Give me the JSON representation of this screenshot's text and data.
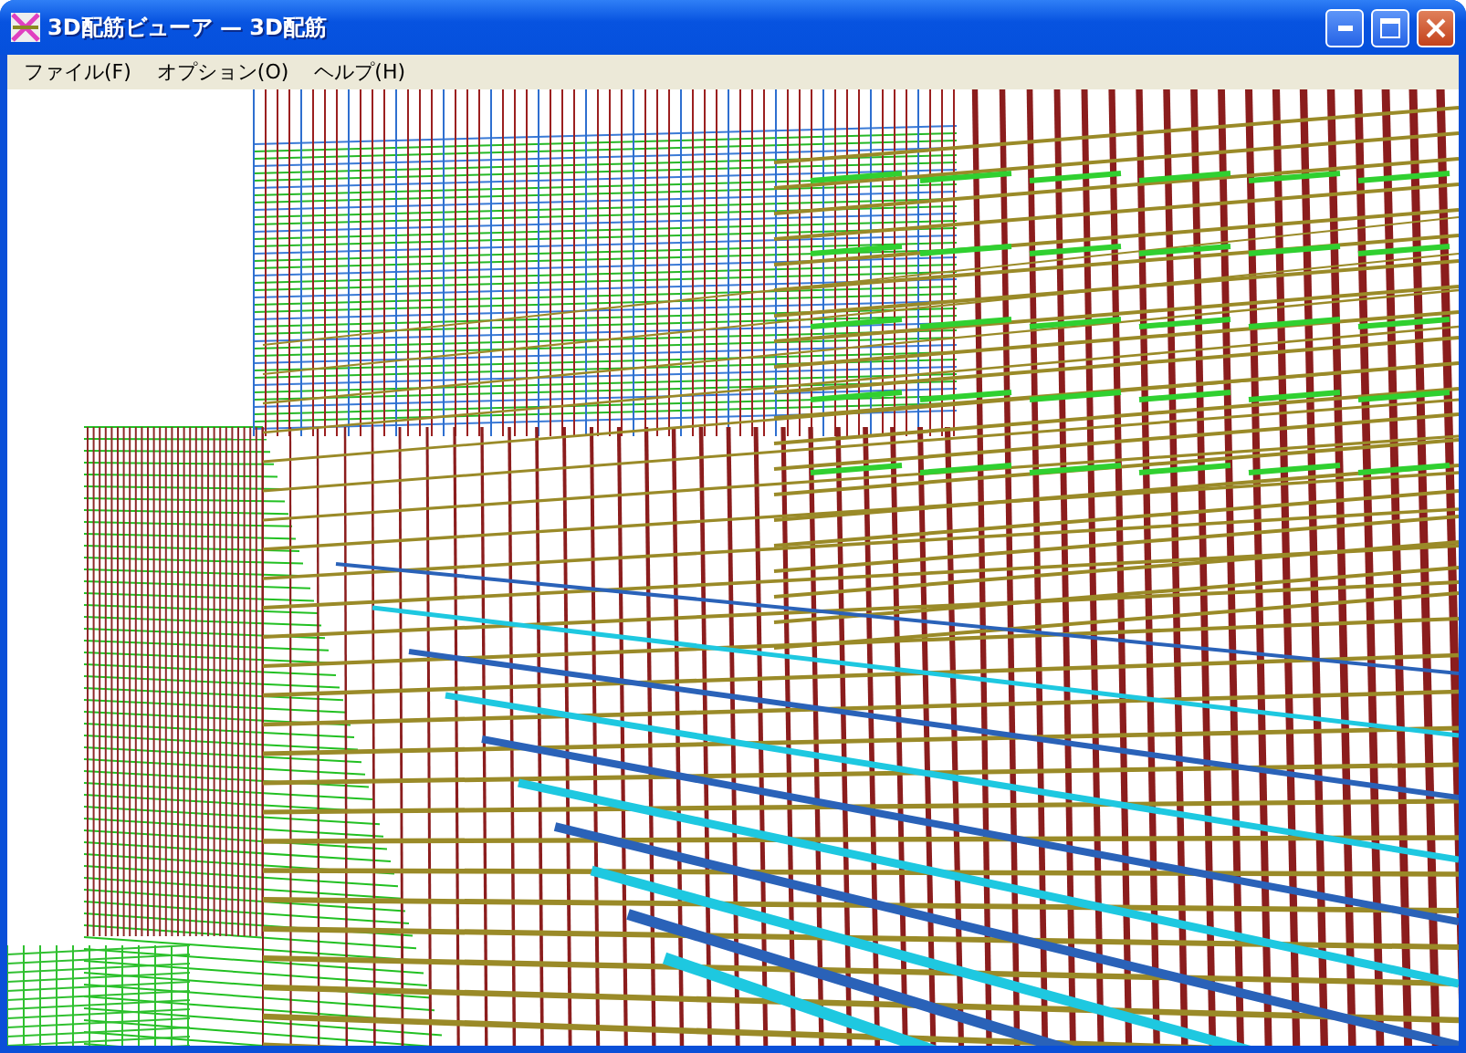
{
  "window": {
    "title": "3D配筋ビューア — 3D配筋"
  },
  "menu": [
    {
      "label": "ファイル(F)"
    },
    {
      "label": "オプション(O)"
    },
    {
      "label": "ヘルプ(H)"
    }
  ]
}
